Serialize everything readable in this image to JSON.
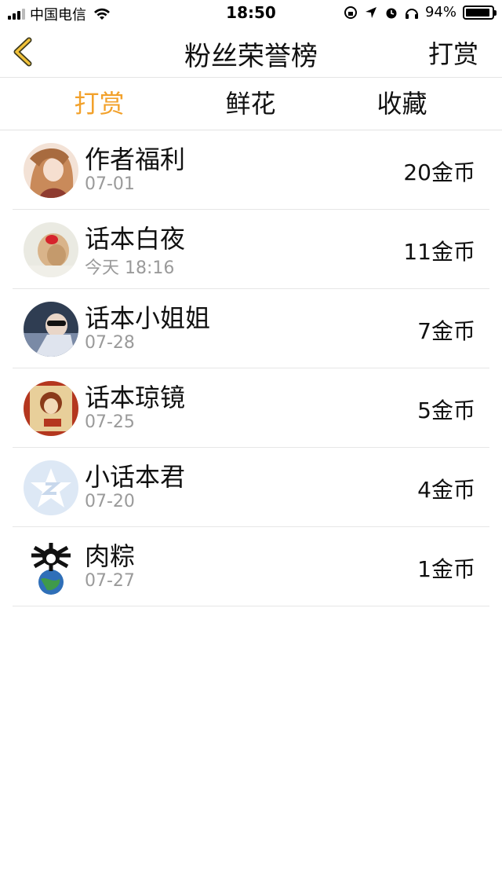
{
  "status_bar": {
    "carrier": "中国电信",
    "time": "18:50",
    "battery": "94%",
    "battery_level": 0.94
  },
  "nav": {
    "title": "粉丝荣誉榜",
    "action": "打赏"
  },
  "tabs": [
    {
      "label": "打赏",
      "active": true
    },
    {
      "label": "鲜花",
      "active": false
    },
    {
      "label": "收藏",
      "active": false
    }
  ],
  "fans": [
    {
      "name": "作者福利",
      "date": "07-01",
      "amount": "20金币"
    },
    {
      "name": "话本白夜",
      "date": "今天 18:16",
      "amount": "11金币"
    },
    {
      "name": "话本小姐姐",
      "date": "07-28",
      "amount": "7金币"
    },
    {
      "name": "话本琼镜",
      "date": "07-25",
      "amount": "5金币"
    },
    {
      "name": "小话本君",
      "date": "07-20",
      "amount": "4金币"
    },
    {
      "name": "肉粽",
      "date": "07-27",
      "amount": "1金币"
    }
  ],
  "colors": {
    "accent": "#f2a12b",
    "text": "#111111",
    "subtext": "#9a9a9a",
    "divider": "#e6e6e6"
  }
}
